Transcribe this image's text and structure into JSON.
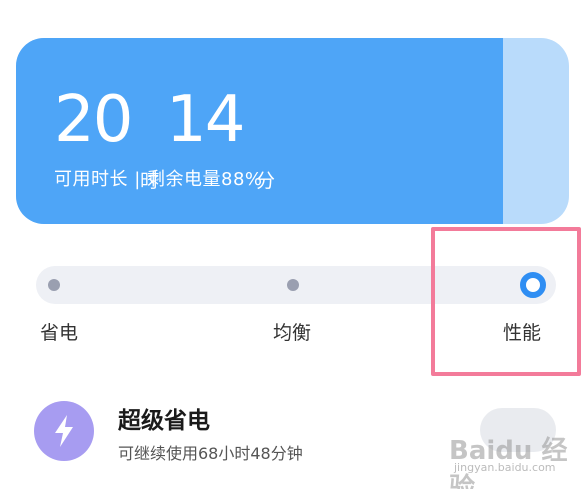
{
  "battery": {
    "hours": "20",
    "hours_unit": "时",
    "minutes": "14",
    "minutes_unit": "分",
    "summary": "可用时长 | 剩余电量88%",
    "fill_fraction": 0.88,
    "fill_color": "#4ea5f7",
    "empty_color": "#b9dbfb"
  },
  "mode": {
    "options": [
      "省电",
      "均衡",
      "性能"
    ],
    "selected": "性能",
    "accent": "#2f8ef3"
  },
  "highlight": {
    "color": "#f37b9a"
  },
  "super_saver": {
    "title": "超级省电",
    "subtitle": "可继续使用68小时48分钟",
    "icon": "lightning-icon",
    "icon_color": "#a79cf1",
    "enabled": false
  },
  "watermark": {
    "logo": "Baidu 经验",
    "url": "jingyan.baidu.com"
  }
}
